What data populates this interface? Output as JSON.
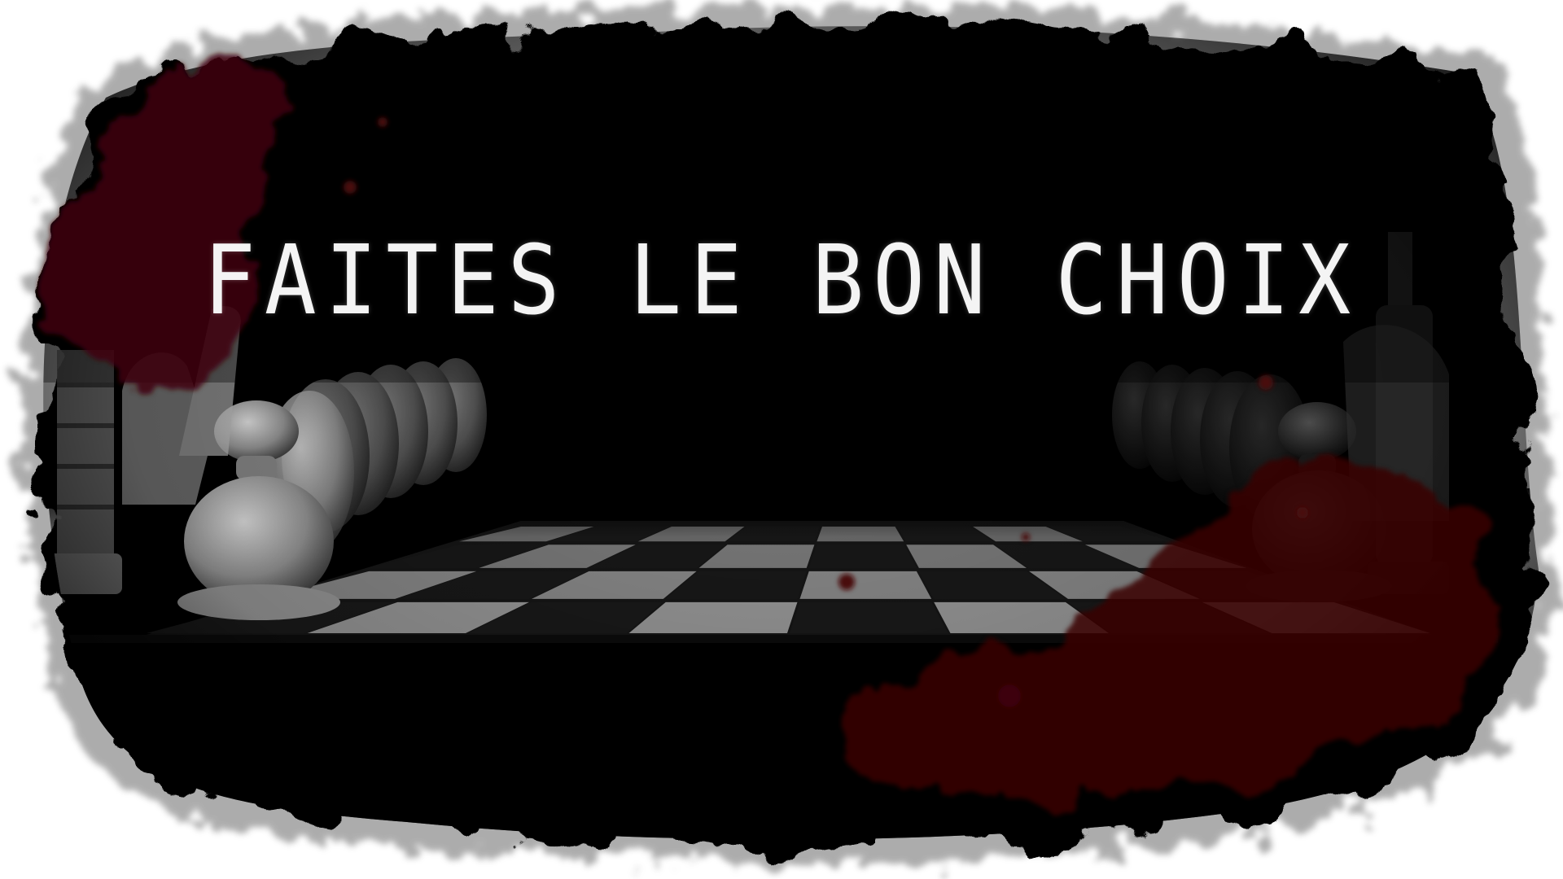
{
  "screen": {
    "title": "FAITES LE BON CHOIX"
  },
  "colors": {
    "background": "#ffffff",
    "frame_black": "#020202",
    "blood_red": "#3e0608",
    "title_text": "#f4f4f4",
    "board_light": "#9a9a9a",
    "board_dark": "#1a1a1a"
  },
  "icons": [
    "chess-pawn-icon",
    "chess-knight-icon",
    "chess-rook-icon",
    "chess-king-icon"
  ]
}
